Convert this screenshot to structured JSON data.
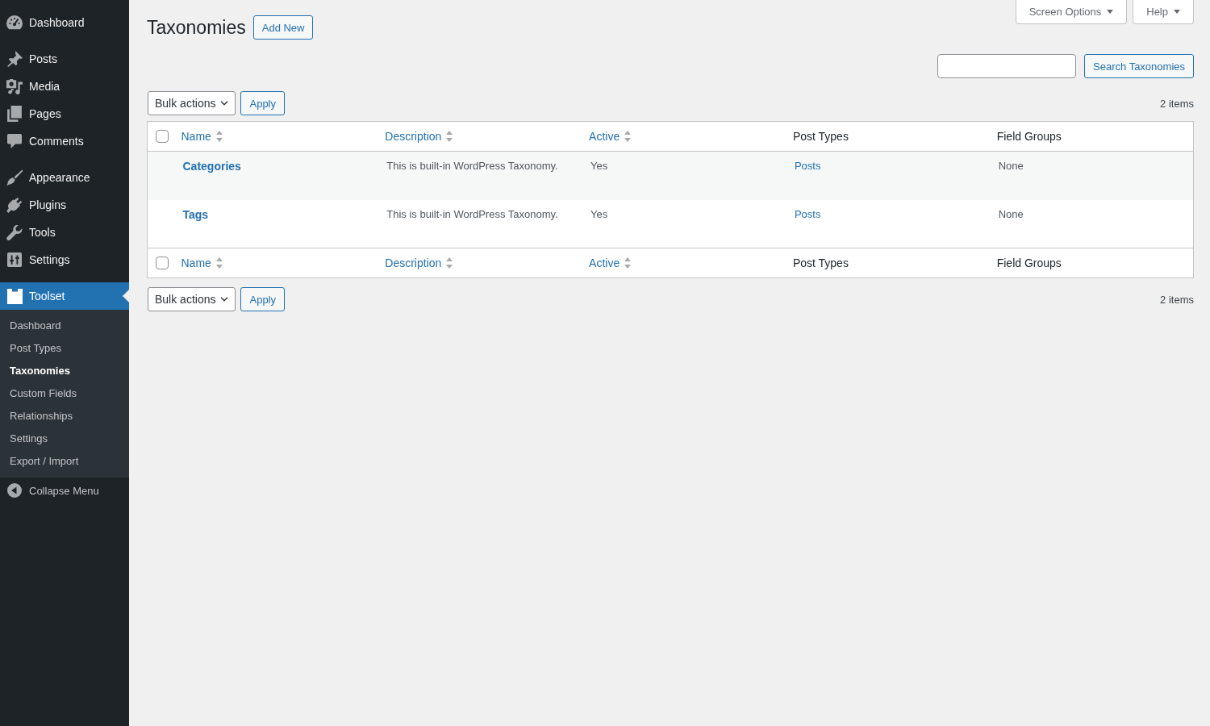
{
  "sidebar": {
    "menu_groups": [
      [
        {
          "label": "Dashboard",
          "selected": false
        }
      ],
      [
        {
          "label": "Posts",
          "selected": false
        },
        {
          "label": "Media",
          "selected": false
        },
        {
          "label": "Pages",
          "selected": false
        },
        {
          "label": "Comments",
          "selected": false
        }
      ],
      [
        {
          "label": "Appearance",
          "selected": false
        },
        {
          "label": "Plugins",
          "selected": false
        },
        {
          "label": "Tools",
          "selected": false
        },
        {
          "label": "Settings",
          "selected": false
        }
      ],
      [
        {
          "label": "Toolset",
          "selected": true,
          "submenu": [
            {
              "label": "Dashboard",
              "selected": false
            },
            {
              "label": "Post Types",
              "selected": false
            },
            {
              "label": "Taxonomies",
              "selected": true
            },
            {
              "label": "Custom Fields",
              "selected": false
            },
            {
              "label": "Relationships",
              "selected": false
            },
            {
              "label": "Settings",
              "selected": false
            },
            {
              "label": "Export / Import",
              "selected": false
            }
          ]
        }
      ]
    ],
    "collapse_menu": "Collapse Menu"
  },
  "screen_meta": [
    {
      "label": "Screen Options"
    },
    {
      "label": "Help"
    }
  ],
  "page_title": "Taxonomies",
  "add_new_button": "Add New",
  "search": {
    "button": "Search Taxonomies"
  },
  "tablenav_top": {
    "bulk_actions": "Bulk actions",
    "apply": "Apply",
    "count": "2 items"
  },
  "table": {
    "header": {
      "checked": false,
      "columns": [
        {
          "label": "Name",
          "sortable": true
        },
        {
          "label": "Description",
          "sortable": true
        },
        {
          "label": "Active",
          "sortable": true
        },
        {
          "label": "Post Types",
          "sortable": false
        },
        {
          "label": "Field Groups",
          "sortable": false
        }
      ]
    },
    "rows": [
      {
        "name": "Categories",
        "description": "This is built-in WordPress Taxonomy.",
        "active": "Yes",
        "post_types": "Posts",
        "field_groups": "None"
      },
      {
        "name": "Tags",
        "description": "This is built-in WordPress Taxonomy.",
        "active": "Yes",
        "post_types": "Posts",
        "field_groups": "None"
      }
    ],
    "footer": {
      "checked": false,
      "columns": [
        {
          "label": "Name",
          "sortable": true
        },
        {
          "label": "Description",
          "sortable": true
        },
        {
          "label": "Active",
          "sortable": true
        },
        {
          "label": "Post Types",
          "sortable": false
        },
        {
          "label": "Field Groups",
          "sortable": false
        }
      ]
    }
  },
  "tablenav_bottom": {
    "bulk_actions": "Bulk actions",
    "apply": "Apply",
    "count": "2 items"
  }
}
